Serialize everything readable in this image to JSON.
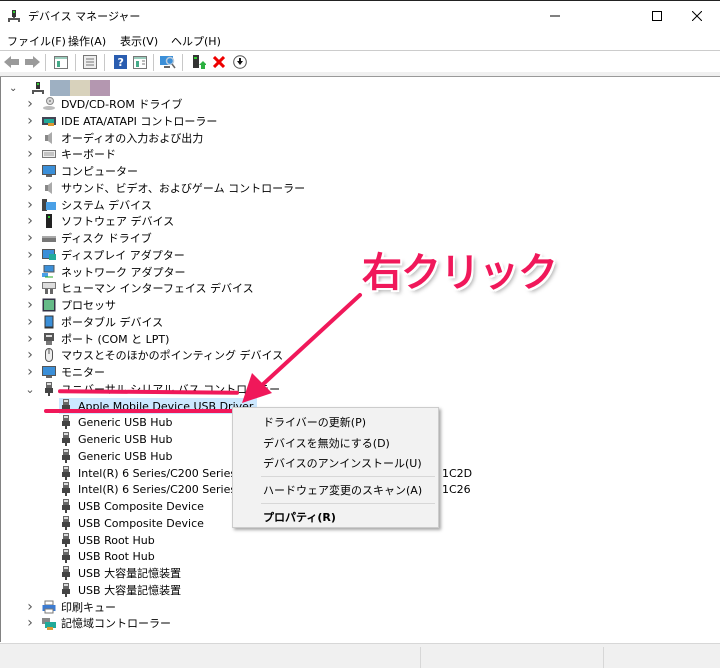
{
  "window": {
    "title": "デバイス マネージャー",
    "buttons": {
      "minimize": "minimize",
      "maximize": "maximize",
      "close": "close"
    }
  },
  "menu": [
    "ファイル(F)",
    "操作(A)",
    "表示(V)",
    "ヘルプ(H)"
  ],
  "toolbar": {
    "icons": [
      "back-arrow",
      "forward-arrow",
      "show-hide-console-tree",
      "properties",
      "help",
      "action-pane",
      "scan-hardware",
      "update-driver",
      "uninstall-device",
      "disable-device"
    ]
  },
  "tree": {
    "root_colors": [
      "#9eb0c2",
      "#d8d2bc",
      "#b497b0"
    ],
    "categories": [
      {
        "label": "DVD/CD-ROM ドライブ",
        "icon": "dvd-drive"
      },
      {
        "label": "IDE ATA/ATAPI コントローラー",
        "icon": "ide-controller"
      },
      {
        "label": "オーディオの入力および出力",
        "icon": "speaker"
      },
      {
        "label": "キーボード",
        "icon": "keyboard"
      },
      {
        "label": "コンピューター",
        "icon": "monitor"
      },
      {
        "label": "サウンド、ビデオ、およびゲーム コントローラー",
        "icon": "speaker"
      },
      {
        "label": "システム デバイス",
        "icon": "system-folder"
      },
      {
        "label": "ソフトウェア デバイス",
        "icon": "software-device"
      },
      {
        "label": "ディスク ドライブ",
        "icon": "disk-drive"
      },
      {
        "label": "ディスプレイ アダプター",
        "icon": "display-adapter"
      },
      {
        "label": "ネットワーク アダプター",
        "icon": "network"
      },
      {
        "label": "ヒューマン インターフェイス デバイス",
        "icon": "hid"
      },
      {
        "label": "プロセッサ",
        "icon": "processor"
      },
      {
        "label": "ポータブル デバイス",
        "icon": "portable"
      },
      {
        "label": "ポート (COM と LPT)",
        "icon": "port"
      },
      {
        "label": "マウスとそのほかのポインティング デバイス",
        "icon": "mouse"
      },
      {
        "label": "モニター",
        "icon": "monitor"
      },
      {
        "label": "ユニバーサル シリアル バス コントローラー",
        "icon": "usb",
        "expanded": true
      }
    ],
    "usb_children": [
      {
        "label": "Apple Mobile Device USB Driver",
        "selected": true
      },
      {
        "label": "Generic USB Hub"
      },
      {
        "label": "Generic USB Hub"
      },
      {
        "label": "Generic USB Hub"
      },
      {
        "label": "Intel(R) 6 Series/C200 Series Chip",
        "suffix": "1C2D"
      },
      {
        "label": "Intel(R) 6 Series/C200 Series Chip",
        "suffix": "1C26"
      },
      {
        "label": "USB Composite Device"
      },
      {
        "label": "USB Composite Device"
      },
      {
        "label": "USB Root Hub"
      },
      {
        "label": "USB Root Hub"
      },
      {
        "label": "USB 大容量記憶装置"
      },
      {
        "label": "USB 大容量記憶装置"
      }
    ],
    "after": [
      {
        "label": "印刷キュー",
        "icon": "printer"
      },
      {
        "label": "記憶域コントローラー",
        "icon": "storage-controller"
      }
    ]
  },
  "context_menu": {
    "items": [
      {
        "label": "ドライバーの更新(P)"
      },
      {
        "label": "デバイスを無効にする(D)"
      },
      {
        "label": "デバイスのアンインストール(U)"
      },
      {
        "label": "ハードウェア変更のスキャン(A)"
      },
      {
        "label": "プロパティ(R)",
        "bold": true
      }
    ]
  },
  "annotation": {
    "text": "右クリック",
    "color": "#f0185a"
  }
}
